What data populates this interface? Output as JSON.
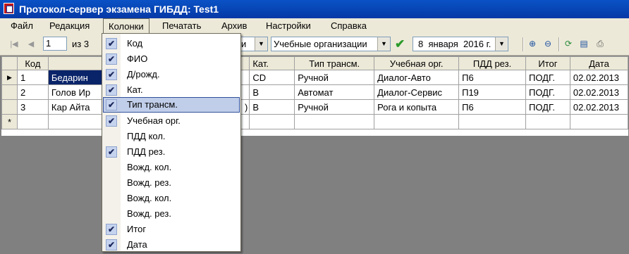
{
  "window": {
    "title": "Протокол-сервер экзамена ГИБДД: Test1"
  },
  "menu": [
    "Файл",
    "Редакция",
    "Колонки",
    "Печатать",
    "Архив",
    "Настройки",
    "Справка"
  ],
  "toolbar": {
    "record_position": "1",
    "record_count": "из 3",
    "group_combo_value": "и",
    "org_combo_value": "Учебные организации",
    "date_day": "8",
    "date_month": "января",
    "date_year": "2016 г."
  },
  "grid": {
    "columns": [
      "Код",
      "",
      "",
      "Кат.",
      "Тип трансм.",
      "Учебная орг.",
      "ПДД рез.",
      "Итог",
      "Дата"
    ],
    "rows": [
      {
        "cells": [
          "1",
          "Бедарин",
          "",
          "CD",
          "Ручной",
          "Диалог-Авто",
          "П6",
          "ПОДГ.",
          "02.02.2013"
        ]
      },
      {
        "cells": [
          "2",
          "Голов Ир",
          "",
          "B",
          "Автомат",
          "Диалог-Сервис",
          "П19",
          "ПОДГ.",
          "02.02.2013"
        ]
      },
      {
        "cells": [
          "3",
          "Кар Айта",
          ")",
          "B",
          "Ручной",
          "Рога и копыта",
          "П6",
          "ПОДГ.",
          "02.02.2013"
        ]
      }
    ],
    "new_row_marker": "*",
    "current_row_marker": "▶"
  },
  "columns_menu": {
    "items": [
      {
        "label": "Код",
        "checked": true
      },
      {
        "label": "ФИО",
        "checked": true
      },
      {
        "label": "Д/рожд.",
        "checked": true
      },
      {
        "label": "Кат.",
        "checked": true
      },
      {
        "label": "Тип трансм.",
        "checked": true
      },
      {
        "label": "Учебная орг.",
        "checked": true
      },
      {
        "label": "ПДД кол.",
        "checked": false
      },
      {
        "label": "ПДД рез.",
        "checked": true
      },
      {
        "label": "Вожд. кол.",
        "checked": false
      },
      {
        "label": "Вожд. рез.",
        "checked": false
      },
      {
        "label": "Вожд. кол.",
        "checked": false
      },
      {
        "label": "Вожд. рез.",
        "checked": false
      },
      {
        "label": "Итог",
        "checked": true
      },
      {
        "label": "Дата",
        "checked": true
      }
    ],
    "highlighted_index": 4,
    "check_glyph": "✔"
  },
  "colors": {
    "title_bar": "#0a52c6",
    "selection": "#0a246a",
    "menu_highlight": "#c1cee9"
  }
}
